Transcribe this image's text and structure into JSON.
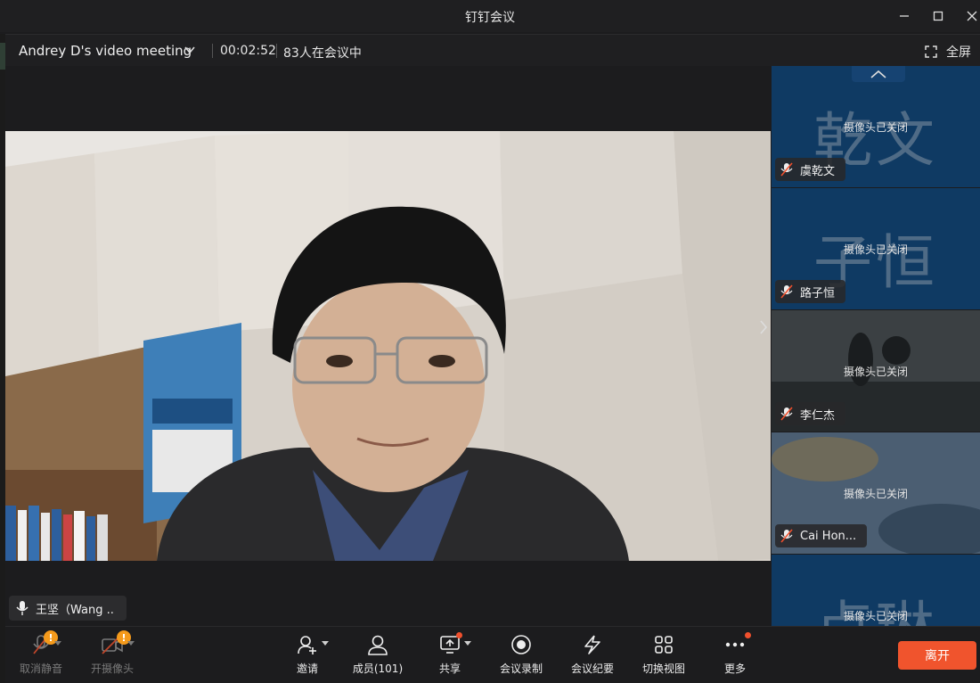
{
  "window": {
    "title": "钉钉会议"
  },
  "infobar": {
    "meeting_title": "Andrey D's video meeting",
    "timer": "00:02:52",
    "participants": "83人在会议中",
    "fullscreen_label": "全屏"
  },
  "main": {
    "speaker_name": "王坚（Wang .."
  },
  "sidebar": {
    "tiles": [
      {
        "bigname": "乾文",
        "status": "摄像头已关闭",
        "name": "虞乾文"
      },
      {
        "bigname": "子恒",
        "status": "摄像头已关闭",
        "name": "路子恒"
      },
      {
        "bigname": "",
        "status": "摄像头已关闭",
        "name": "李仁杰"
      },
      {
        "bigname": "",
        "status": "摄像头已关闭",
        "name": "Cai   Hon..."
      },
      {
        "bigname": "卢琳",
        "status": "摄像头已关闭",
        "name": ""
      }
    ]
  },
  "toolbar": {
    "unmute": "取消静音",
    "camera": "开摄像头",
    "invite": "邀请",
    "members": "成员(101)",
    "share": "共享",
    "record": "会议录制",
    "minutes": "会议纪要",
    "view": "切换视图",
    "more": "更多",
    "leave": "离开",
    "warning_badge": "!"
  },
  "colors": {
    "tile_bg": "#0f3a63",
    "leave_button": "#f0542d",
    "warning_badge": "#f59a1b"
  }
}
